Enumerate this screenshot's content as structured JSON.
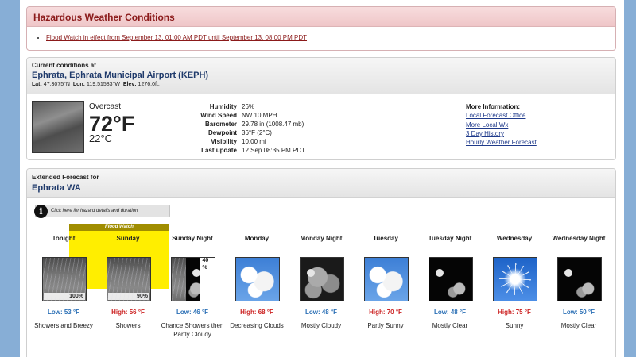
{
  "hazard": {
    "title": "Hazardous Weather Conditions",
    "items": [
      "Flood Watch in effect from September 13, 01:00 AM PDT until September 13, 08:00 PM PDT"
    ]
  },
  "current": {
    "heading": "Current conditions at",
    "station": "Ephrata, Ephrata Municipal Airport (KEPH)",
    "lat_label": "Lat:",
    "lat": "47.3075°N",
    "lon_label": "Lon:",
    "lon": "119.51583°W",
    "elev_label": "Elev:",
    "elev": "1276.0ft.",
    "condition": "Overcast",
    "temp_f": "72°F",
    "temp_c": "22°C",
    "details": [
      {
        "k": "Humidity",
        "v": "26%"
      },
      {
        "k": "Wind Speed",
        "v": "NW 10 MPH"
      },
      {
        "k": "Barometer",
        "v": "29.78 in (1008.47 mb)"
      },
      {
        "k": "Dewpoint",
        "v": "36°F (2°C)"
      },
      {
        "k": "Visibility",
        "v": "10.00 mi"
      },
      {
        "k": "Last update",
        "v": "12 Sep 08:35 PM PDT"
      }
    ],
    "more_title": "More Information:",
    "more_links": [
      "Local Forecast Office",
      "More Local Wx",
      "3 Day History",
      "Hourly Weather Forecast"
    ]
  },
  "extended": {
    "heading": "Extended Forecast for",
    "location": "Ephrata WA",
    "hazard_button": "Click here for hazard details and duration",
    "flood_label": "Flood Watch",
    "periods": [
      {
        "name": "Tonight",
        "icon": "rain-icon",
        "pop": "100%",
        "temp": "Low: 53 °F",
        "kind": "low",
        "short": "Showers and Breezy"
      },
      {
        "name": "Sunday",
        "icon": "rain-icon",
        "pop": "90%",
        "temp": "High: 56 °F",
        "kind": "high",
        "short": "Showers"
      },
      {
        "name": "Sunday Night",
        "icon": "rain-then-night-icon",
        "pop": "40 %",
        "temp": "Low: 46 °F",
        "kind": "low",
        "short": "Chance Showers then Partly Cloudy"
      },
      {
        "name": "Monday",
        "icon": "partly-cloudy-icon",
        "pop": "",
        "temp": "High: 68 °F",
        "kind": "high",
        "short": "Decreasing Clouds"
      },
      {
        "name": "Monday Night",
        "icon": "night-cloudy-icon",
        "pop": "",
        "temp": "Low: 48 °F",
        "kind": "low",
        "short": "Mostly Cloudy"
      },
      {
        "name": "Tuesday",
        "icon": "partly-sunny-icon",
        "pop": "",
        "temp": "High: 70 °F",
        "kind": "high",
        "short": "Partly Sunny"
      },
      {
        "name": "Tuesday Night",
        "icon": "night-clear-icon",
        "pop": "",
        "temp": "Low: 48 °F",
        "kind": "low",
        "short": "Mostly Clear"
      },
      {
        "name": "Wednesday",
        "icon": "sunny-icon",
        "pop": "",
        "temp": "High: 75 °F",
        "kind": "high",
        "short": "Sunny"
      },
      {
        "name": "Wednesday Night",
        "icon": "night-clear-icon",
        "pop": "",
        "temp": "Low: 50 °F",
        "kind": "low",
        "short": "Mostly Clear"
      }
    ]
  },
  "colors": {
    "page_bg": "#87aed6",
    "hazard_text": "#8b1a1a",
    "flood_band": "#ffee00",
    "low_temp": "#2a6fb5",
    "high_temp": "#cc2222"
  }
}
